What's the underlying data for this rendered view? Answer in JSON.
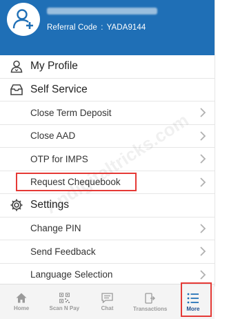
{
  "header": {
    "referral_label": "Referral Code",
    "referral_sep": ":",
    "referral_code": "YADA9144"
  },
  "sections": [
    {
      "label": "My Profile",
      "icon": "profile-icon"
    },
    {
      "label": "Self Service",
      "icon": "inbox-icon",
      "items": [
        "Close Term Deposit",
        "Close AAD",
        "OTP for IMPS",
        "Request Chequebook"
      ]
    },
    {
      "label": "Settings",
      "icon": "gear-icon",
      "items": [
        "Change PIN",
        "Send Feedback",
        "Language Selection"
      ]
    }
  ],
  "watermark": "Andigitaltricks.com",
  "bottom_nav": [
    {
      "label": "Home",
      "icon": "home-icon"
    },
    {
      "label": "Scan N Pay",
      "icon": "qr-icon"
    },
    {
      "label": "Chat",
      "icon": "chat-icon"
    },
    {
      "label": "Transactions",
      "icon": "transactions-icon"
    },
    {
      "label": "More",
      "icon": "list-icon",
      "active": true
    }
  ],
  "colors": {
    "brand": "#1f6fb6",
    "highlight": "#e53935",
    "nav_inactive": "#9a9a9a"
  }
}
